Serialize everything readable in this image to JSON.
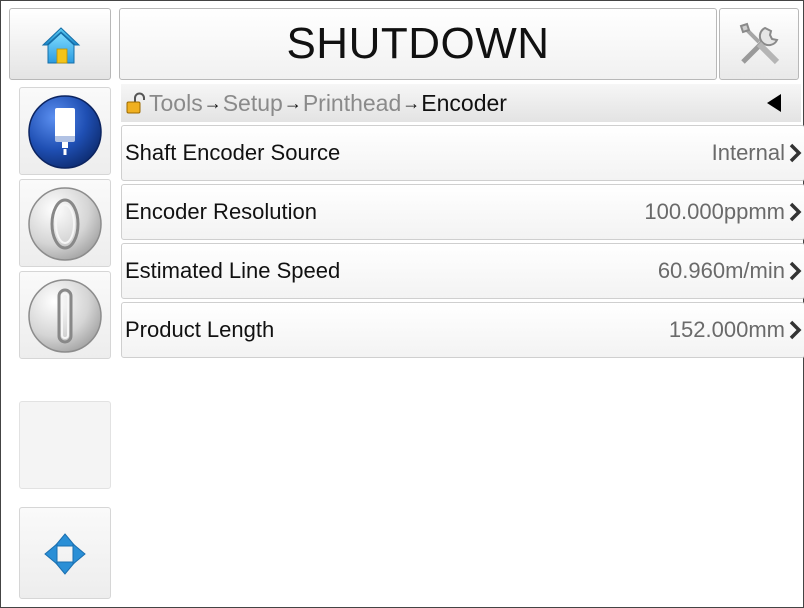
{
  "header": {
    "title": "SHUTDOWN",
    "home_icon": "home-icon",
    "tools_icon": "tools-icon"
  },
  "sidebar": {
    "buttons": [
      {
        "name": "ink-status-button",
        "icon": "ink-bottle-icon",
        "color": "#1f4fb3"
      },
      {
        "name": "jet-start-button",
        "icon": "jet-start-icon"
      },
      {
        "name": "print-toggle-button",
        "icon": "print-start-icon"
      },
      {
        "name": "empty-slot",
        "icon": ""
      },
      {
        "name": "navigation-button",
        "icon": "navigation-arrows-icon",
        "color": "#2a8fd6"
      }
    ]
  },
  "breadcrumb": {
    "items": [
      "Tools",
      "Setup",
      "Printhead",
      "Encoder"
    ],
    "separator": "→",
    "lock_icon": "unlocked-padlock-icon",
    "back_icon": "back-arrow-icon"
  },
  "settings": [
    {
      "label": "Shaft Encoder Source",
      "value": "Internal"
    },
    {
      "label": "Encoder Resolution",
      "value": "100.000ppmm"
    },
    {
      "label": "Estimated Line Speed",
      "value": "60.960m/min"
    },
    {
      "label": "Product Length",
      "value": "152.000mm"
    }
  ]
}
